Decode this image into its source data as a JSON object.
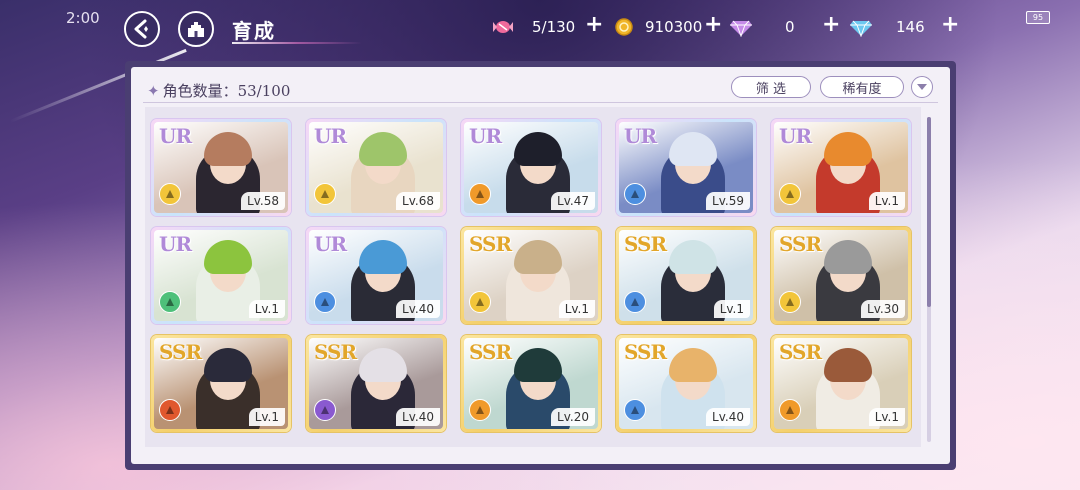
{
  "status": {
    "time": "2:00",
    "battery": "95"
  },
  "header": {
    "title": "育成"
  },
  "resources": [
    {
      "name": "candy",
      "icon": "candy-icon",
      "value": "5/130",
      "color": "#f06a9c"
    },
    {
      "name": "coin",
      "icon": "coin-icon",
      "value": "910300",
      "color": "#f1b62a"
    },
    {
      "name": "gem-pink",
      "icon": "pink-diamond-icon",
      "value": "0",
      "color": "#c58be8"
    },
    {
      "name": "gem-blue",
      "icon": "blue-diamond-icon",
      "value": "146",
      "color": "#6cc8f0"
    }
  ],
  "panel": {
    "count_label": "角色数量：",
    "count_value": "53/100",
    "filter_label": "筛 选",
    "sort_label": "稀有度"
  },
  "classes": {
    "yellow": "#f2c53a",
    "orange": "#f09a2a",
    "blue": "#4d8fe0",
    "green": "#4ec07a",
    "purple": "#8a5ad0",
    "red": "#e0582e"
  },
  "cards": [
    {
      "rarity": "UR",
      "level": "Lv.58",
      "class_color": "yellow",
      "hair": "#b57c5f",
      "outfit": "#2b2630",
      "bg": "#d9c4b8"
    },
    {
      "rarity": "UR",
      "level": "Lv.68",
      "class_color": "yellow",
      "hair": "#9ec56a",
      "outfit": "#e8d6c0",
      "bg": "#e9e2cf"
    },
    {
      "rarity": "UR",
      "level": "Lv.47",
      "class_color": "orange",
      "hair": "#1e1f2b",
      "outfit": "#2a2b38",
      "bg": "#c7dceb"
    },
    {
      "rarity": "UR",
      "level": "Lv.59",
      "class_color": "blue",
      "hair": "#dfe6f3",
      "outfit": "#3a4c8a",
      "bg": "#7a8cc5"
    },
    {
      "rarity": "UR",
      "level": "Lv.1",
      "class_color": "yellow",
      "hair": "#e88a2e",
      "outfit": "#c43a2c",
      "bg": "#dfc3a0"
    },
    {
      "rarity": "UR",
      "level": "Lv.1",
      "class_color": "green",
      "hair": "#8cc43e",
      "outfit": "#e9efe6",
      "bg": "#d8e3d2"
    },
    {
      "rarity": "UR",
      "level": "Lv.40",
      "class_color": "blue",
      "hair": "#4a9ad6",
      "outfit": "#2a2b36",
      "bg": "#c9dcec"
    },
    {
      "rarity": "SSR",
      "level": "Lv.1",
      "class_color": "yellow",
      "hair": "#c9b08a",
      "outfit": "#efe6dc",
      "bg": "#ddd2c5"
    },
    {
      "rarity": "SSR",
      "level": "Lv.1",
      "class_color": "blue",
      "hair": "#cfe3e6",
      "outfit": "#2a2d3a",
      "bg": "#cfe0ea"
    },
    {
      "rarity": "SSR",
      "level": "Lv.30",
      "class_color": "yellow",
      "hair": "#9a9a9a",
      "outfit": "#3a3a40",
      "bg": "#cfc0a8"
    },
    {
      "rarity": "SSR",
      "level": "Lv.1",
      "class_color": "red",
      "hair": "#2a2a3a",
      "outfit": "#3a2f2a",
      "bg": "#b99273"
    },
    {
      "rarity": "SSR",
      "level": "Lv.40",
      "class_color": "purple",
      "hair": "#e4e0e6",
      "outfit": "#2b2838",
      "bg": "#a99a9a"
    },
    {
      "rarity": "SSR",
      "level": "Lv.20",
      "class_color": "orange",
      "hair": "#1f3b3a",
      "outfit": "#2a4a6a",
      "bg": "#bfd8d0"
    },
    {
      "rarity": "SSR",
      "level": "Lv.40",
      "class_color": "blue",
      "hair": "#e8b36a",
      "outfit": "#cfe2ee",
      "bg": "#d8e6ef"
    },
    {
      "rarity": "SSR",
      "level": "Lv.1",
      "class_color": "orange",
      "hair": "#9a5a3a",
      "outfit": "#f0ece4",
      "bg": "#d9cfb8"
    }
  ]
}
